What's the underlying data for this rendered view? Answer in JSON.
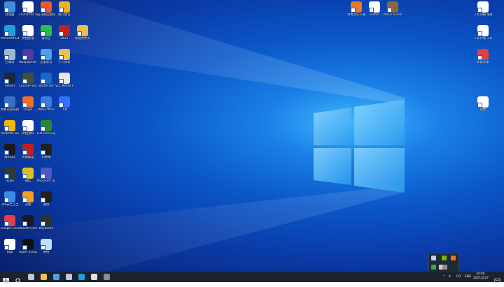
{
  "desktop": {
    "icons": [
      {
        "label": "此电脑",
        "color": "#3f8fd8"
      },
      {
        "label": "20201204 XNXX信息",
        "color": "#ffffff"
      },
      {
        "label": "向日葵远程控制",
        "color": "#e85a2a"
      },
      {
        "label": "腾讯会议",
        "color": "#f0b020"
      },
      {
        "label": "Microsoft Edge",
        "color": "#1fa0d8"
      },
      {
        "label": "文档处理",
        "color": "#ffffff"
      },
      {
        "label": "爱奇艺",
        "color": "#29c04a"
      },
      {
        "label": "2K21",
        "color": "#c02020"
      },
      {
        "label": "新建文件夹",
        "color": "#e8c050"
      },
      {
        "label": "回收站",
        "color": "#9fb8d0"
      },
      {
        "label": "WallpaperEngine",
        "color": "#4f3aa8"
      },
      {
        "label": "迅雷影音",
        "color": "#4aa0f0"
      },
      {
        "label": "学习资料",
        "color": "#e8c050"
      },
      {
        "label": "Steam",
        "color": "#1b2838"
      },
      {
        "label": "Counter-Strike",
        "color": "#405030"
      },
      {
        "label": "Battle.net",
        "color": "#1868c8"
      },
      {
        "label": "VLC Media Player",
        "color": "#e8e8e8"
      },
      {
        "label": "网易有道词典",
        "color": "#3a6fc8"
      },
      {
        "label": "Origin",
        "color": "#f07020"
      },
      {
        "label": "WPS Office",
        "color": "#3a7be0"
      },
      {
        "label": "飞书",
        "color": "#3370ff"
      },
      {
        "label": "Rockstar Games",
        "color": "#f4b400"
      },
      {
        "label": "文档资料",
        "color": "#ffffff"
      },
      {
        "label": "GeForce Experience",
        "color": "#2a8a2a"
      },
      {
        "label": "腾讯QQ",
        "color": "#1a1a1a"
      },
      {
        "label": "英雄联盟",
        "color": "#c02020"
      },
      {
        "label": "记事本",
        "color": "#202020"
      },
      {
        "label": "Uplay",
        "color": "#2e3a2a"
      },
      {
        "label": "微信",
        "color": "#e0c020"
      },
      {
        "label": "Microsoft Teams",
        "color": "#5058c8"
      },
      {
        "label": "360安全卫士",
        "color": "#3a8ae8"
      },
      {
        "label": "迅雷",
        "color": "#f0a020"
      },
      {
        "label": "键盘",
        "color": "#202020"
      },
      {
        "label": "Google Chrome",
        "color": "#e04040"
      },
      {
        "label": "Ubisoft Connect",
        "color": "#1a1a1a"
      },
      {
        "label": "Keyboard",
        "color": "#303030"
      },
      {
        "label": "新建",
        "color": "#ffffff"
      },
      {
        "label": "Razer Synapse",
        "color": "#101010"
      },
      {
        "label": "网络",
        "color": "#c0e0ff"
      },
      {
        "label": "付费音乐下载",
        "color": "#e87828"
      },
      {
        "label": "Steam",
        "color": "#ffffff"
      },
      {
        "label": "Music & Radio",
        "color": "#8a6a3a"
      },
      {
        "label": "工作简报-张建平",
        "color": "#ffffff"
      },
      {
        "label": "工作计划-工作日报整理",
        "color": "#ffffff"
      },
      {
        "label": "新建文本",
        "color": "#e04040"
      },
      {
        "label": "新建",
        "color": "#ffffff"
      }
    ]
  },
  "tray_popup": {
    "items": [
      {
        "name": "steam-tray-icon",
        "color": "#c8d0e0"
      },
      {
        "name": "nvidia-tray-icon",
        "color": "#76b900"
      },
      {
        "name": "origin-tray-icon",
        "color": "#f07020"
      },
      {
        "name": "wechat-tray-icon",
        "color": "#2ab04a"
      },
      {
        "name": "usb-tray-icon",
        "color": "#d0d0d0"
      },
      {
        "name": "ubisoft-tray-icon",
        "color": "#909090"
      }
    ]
  },
  "taskbar": {
    "start_icon": "windows-logo",
    "search_icon": "search-icon",
    "pinned": [
      {
        "name": "task-view-icon",
        "color": "#c0c8d8"
      },
      {
        "name": "file-explorer-icon",
        "color": "#f0c040"
      },
      {
        "name": "mail-icon",
        "color": "#4aa0f0"
      },
      {
        "name": "steam-taskbar-icon",
        "color": "#c0c8d8"
      },
      {
        "name": "edge-taskbar-icon",
        "color": "#1fa0d8"
      },
      {
        "name": "clock-app-icon",
        "color": "#e0e0e0"
      },
      {
        "name": "app-taskbar-icon",
        "color": "#8090a8"
      }
    ],
    "clock": {
      "time": "20:09",
      "date": "2021/2/27"
    },
    "lang": "ENG",
    "tray_text": "A",
    "zoom_text": "CO"
  }
}
